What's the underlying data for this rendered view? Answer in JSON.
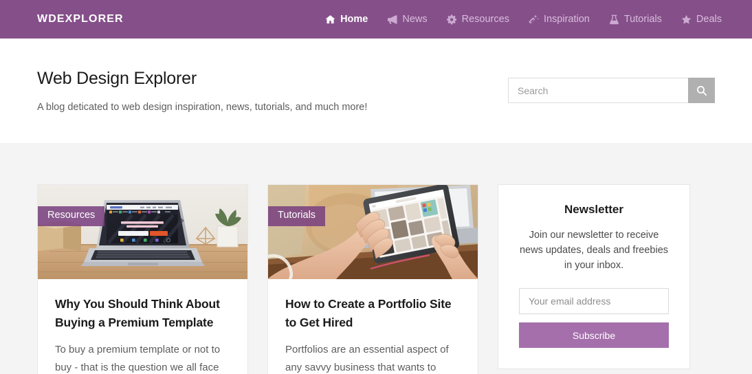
{
  "navbar": {
    "brand": "WDEXPLORER",
    "items": [
      {
        "label": "Home",
        "icon": "home-icon",
        "active": true
      },
      {
        "label": "News",
        "icon": "bullhorn-icon",
        "active": false
      },
      {
        "label": "Resources",
        "icon": "gear-icon",
        "active": false
      },
      {
        "label": "Inspiration",
        "icon": "magic-wand-icon",
        "active": false
      },
      {
        "label": "Tutorials",
        "icon": "flask-icon",
        "active": false
      },
      {
        "label": "Deals",
        "icon": "star-icon",
        "active": false
      }
    ]
  },
  "header": {
    "title": "Web Design Explorer",
    "subtitle": "A blog deticated to web design inspiration, news, tutorials, and much more!",
    "search_placeholder": "Search",
    "search_value": "",
    "search_icon": "search-icon"
  },
  "posts": [
    {
      "badge": "Resources",
      "title": "Why You Should Think About Buying a Premium Template",
      "excerpt": "To buy a premium template or not to buy - that is the question we all face",
      "image_alt": "laptop-on-desk-photo"
    },
    {
      "badge": "Tutorials",
      "title": "How to Create a Portfolio Site to Get Hired",
      "excerpt": "Portfolios are an essential aspect of any savvy business that wants to",
      "image_alt": "hands-using-tablet-photo"
    }
  ],
  "newsletter": {
    "title": "Newsletter",
    "text": "Join our newsletter to receive news updates, deals and freebies in your inbox.",
    "email_placeholder": "Your email address",
    "email_value": "",
    "button": "Subscribe"
  },
  "colors": {
    "brand_purple": "#85508a",
    "badge_purple": "#7a4280",
    "button_purple": "#a46faa",
    "page_background": "#f4f4f4",
    "search_button_gray": "#b0b0b0"
  }
}
